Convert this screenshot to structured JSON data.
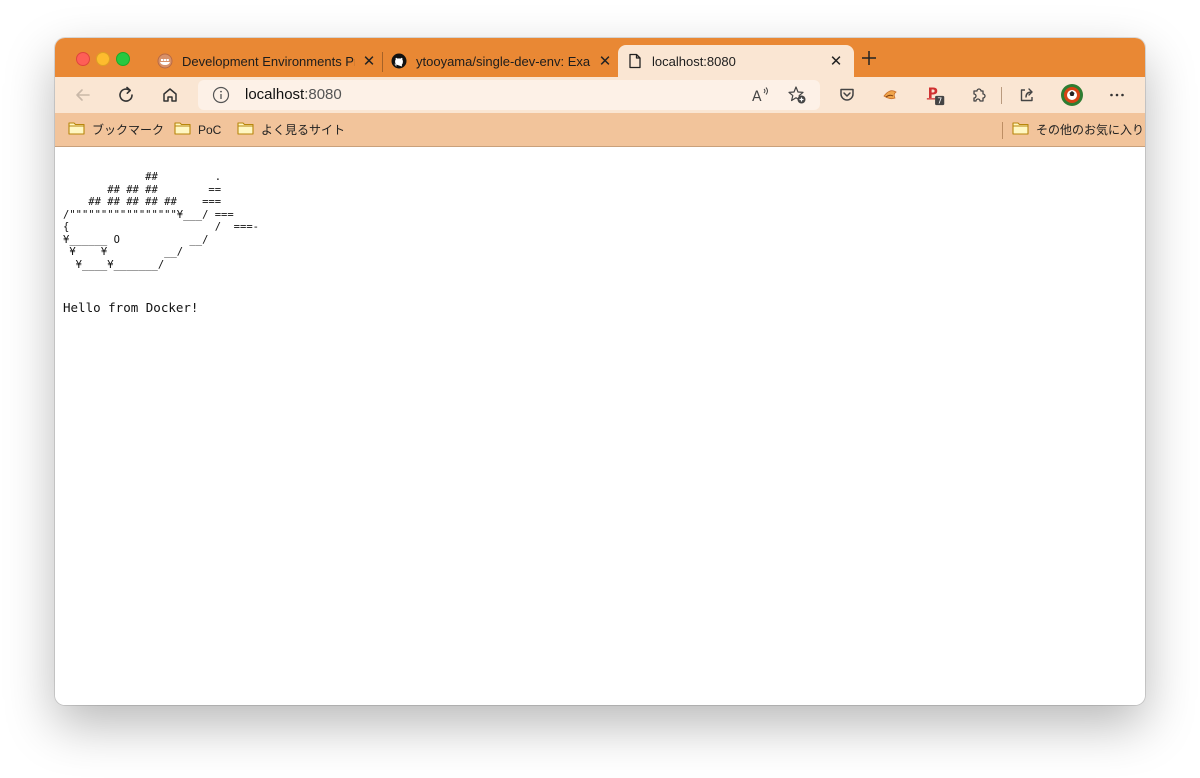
{
  "tabs": [
    {
      "title": "Development Environments Pr",
      "favicon": "docker-icon"
    },
    {
      "title": "ytooyama/single-dev-env: Exa",
      "favicon": "github-icon"
    },
    {
      "title": "localhost:8080",
      "favicon": "page-icon",
      "active": true
    }
  ],
  "toolbar": {
    "address_host": "localhost",
    "address_port": ":8080",
    "profile_badge_count": "7"
  },
  "bookmarks": {
    "items": [
      "ブックマーク",
      "PoC",
      "よく見るサイト"
    ],
    "other": "その他のお気に入り"
  },
  "page": {
    "ascii_art": "             ##         .\n       ## ## ##        ==\n    ## ## ## ## ##    ===\n/\"\"\"\"\"\"\"\"\"\"\"\"\"\"\"\"\"¥___/ ===\n{                       /  ===-\n¥______ O           __/\n ¥    ¥         __/\n  ¥____¥_______/",
    "message": "Hello from Docker!"
  },
  "colors": {
    "tabstrip": "#e98834",
    "toolbar": "#fae6d3",
    "bookmarks_bar": "#f2c49b"
  }
}
